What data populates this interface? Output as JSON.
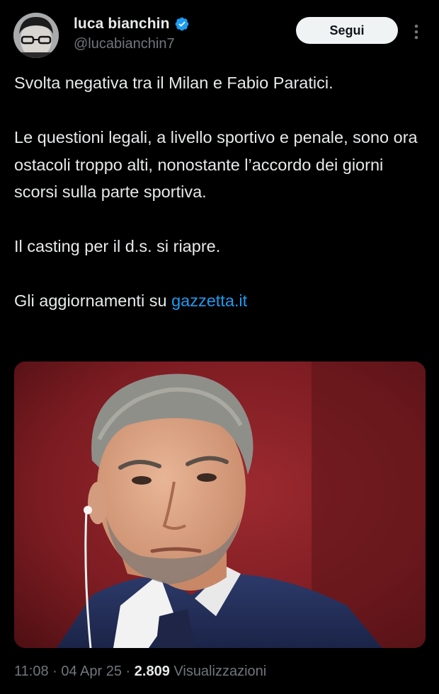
{
  "author": {
    "display_name": "luca bianchin",
    "handle": "@lucabianchin7",
    "verified": true,
    "verified_color": "#1d9bf0"
  },
  "actions": {
    "follow_label": "Segui",
    "more_icon": "more-vertical-icon"
  },
  "tweet": {
    "paragraph1": "Svolta negativa tra il Milan e Fabio Paratici.",
    "paragraph2": "Le questioni legali, a livello sportivo e penale, sono ora ostacoli troppo alti, nonostante l’accordo dei giorni scorsi sulla parte sportiva.",
    "paragraph3": "Il casting per il d.s. si riapre.",
    "paragraph4_prefix": "Gli aggiornamenti su ",
    "link_text": "gazzetta.it",
    "link_color": "#1d9bf0"
  },
  "media": {
    "kind": "photo"
  },
  "meta": {
    "time": "11:08",
    "separator": " · ",
    "date": "04 Apr 25",
    "views_count": "2.809",
    "views_label": "Visualizzazioni"
  }
}
